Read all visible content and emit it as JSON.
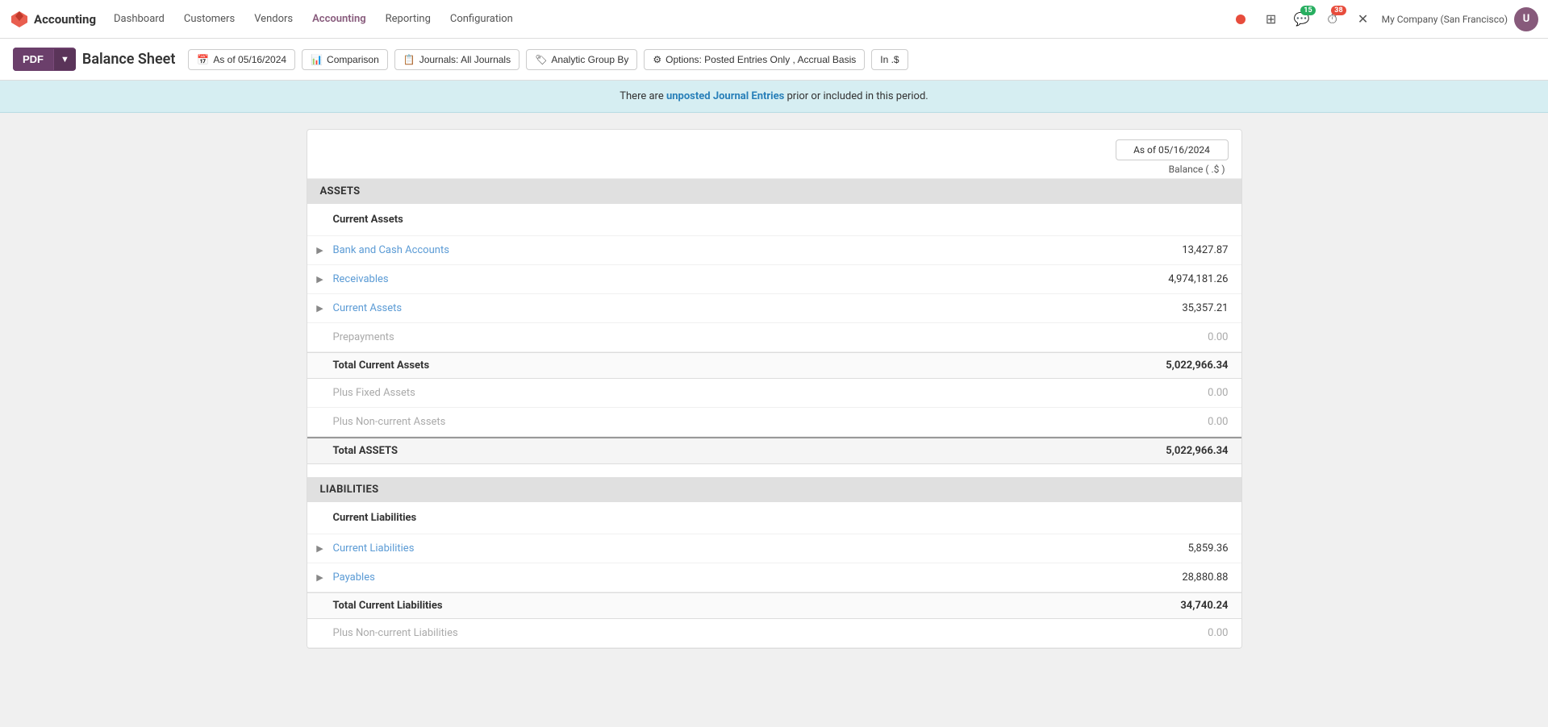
{
  "nav": {
    "brand": "Accounting",
    "links": [
      "Dashboard",
      "Customers",
      "Vendors",
      "Accounting",
      "Reporting",
      "Configuration"
    ],
    "active_link": "Accounting",
    "company": "My Company (San Francisco)",
    "badges": {
      "messages": "15",
      "clock": "38"
    }
  },
  "toolbar": {
    "pdf_label": "PDF",
    "page_title": "Balance Sheet",
    "filters": [
      {
        "id": "date",
        "icon": "📅",
        "label": "As of 05/16/2024"
      },
      {
        "id": "comparison",
        "icon": "📊",
        "label": "Comparison"
      },
      {
        "id": "journals",
        "icon": "📋",
        "label": "Journals: All Journals"
      },
      {
        "id": "analytic",
        "icon": "🏷",
        "label": "Analytic Group By"
      },
      {
        "id": "options",
        "icon": "⚙",
        "label": "Options: Posted Entries Only , Accrual Basis"
      },
      {
        "id": "currency",
        "icon": "",
        "label": "In .$"
      }
    ]
  },
  "banner": {
    "text_before": "There are ",
    "text_bold": "unposted Journal Entries",
    "text_after": " prior or included in this period."
  },
  "report": {
    "date_header": "As of 05/16/2024",
    "balance_header": "Balance ( .$ )",
    "sections": [
      {
        "id": "assets",
        "header": "ASSETS",
        "sub_sections": [
          {
            "label": "Current Assets",
            "rows": [
              {
                "label": "Bank and Cash Accounts",
                "value": "13,427.87",
                "expandable": true,
                "link": true,
                "muted": false
              },
              {
                "label": "Receivables",
                "value": "4,974,181.26",
                "expandable": true,
                "link": true,
                "muted": false
              },
              {
                "label": "Current Assets",
                "value": "35,357.21",
                "expandable": true,
                "link": true,
                "muted": false
              },
              {
                "label": "Prepayments",
                "value": "0.00",
                "expandable": false,
                "link": false,
                "muted": true
              }
            ],
            "total_label": "Total Current Assets",
            "total_value": "5,022,966.34"
          }
        ],
        "extra_rows": [
          {
            "label": "Plus Fixed Assets",
            "value": "0.00",
            "muted": true
          },
          {
            "label": "Plus Non-current Assets",
            "value": "0.00",
            "muted": true
          }
        ],
        "total_label": "Total ASSETS",
        "total_value": "5,022,966.34"
      },
      {
        "id": "liabilities",
        "header": "LIABILITIES",
        "sub_sections": [
          {
            "label": "Current Liabilities",
            "rows": [
              {
                "label": "Current Liabilities",
                "value": "5,859.36",
                "expandable": true,
                "link": true,
                "muted": false
              },
              {
                "label": "Payables",
                "value": "28,880.88",
                "expandable": true,
                "link": true,
                "muted": false
              }
            ],
            "total_label": "Total Current Liabilities",
            "total_value": "34,740.24"
          }
        ],
        "extra_rows": [
          {
            "label": "Plus Non-current Liabilities",
            "value": "0.00",
            "muted": true
          }
        ],
        "total_label": null,
        "total_value": null
      }
    ]
  }
}
